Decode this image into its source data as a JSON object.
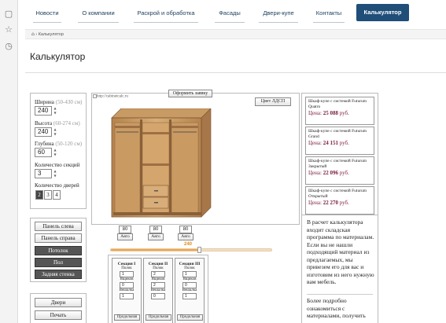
{
  "nav": {
    "items": [
      "Новости",
      "О компании",
      "Раскрой и обработка",
      "Фасады",
      "Двери-купе",
      "Контакты",
      "Калькулятор"
    ]
  },
  "breadcrumb": {
    "home_icon": "home-icon",
    "separator": "›",
    "current": "Калькулятор"
  },
  "page": {
    "title": "Калькулятор"
  },
  "form": {
    "width_label": "Ширина",
    "width_range": "(50-430 см)",
    "width_value": "240",
    "height_label": "Высота",
    "height_range": "(60-274 см)",
    "height_value": "240",
    "depth_label": "Глубина",
    "depth_range": "(50-120 см)",
    "depth_value": "60",
    "sections_label": "Количество секций",
    "sections_value": "3",
    "doors_label": "Количество дверей",
    "doors_options": [
      "2",
      "3",
      "4"
    ],
    "doors_selected": "2"
  },
  "panel_buttons": [
    "Панель слева",
    "Панель справа",
    "Потолок",
    "Пол",
    "Задняя стенка"
  ],
  "bottom_buttons": [
    "Двери",
    "Печать"
  ],
  "preview": {
    "order_button": "Оформить заявку",
    "color_button": "Цвет ЛДСП",
    "image_alt": "http://cabinetcalc.ru",
    "width_slider_value": "240",
    "width_slider_fraction": 0.55,
    "section_widths": [
      "80",
      "80",
      "80"
    ],
    "auto_label": "Авто"
  },
  "sections": [
    {
      "title": "Секция I",
      "shelf_label": "Полок",
      "shelf": "1",
      "drawer_label": "Ящиков",
      "drawer": "0",
      "hanger_label": "Вешалка",
      "hanger": "1",
      "button": "Продольная"
    },
    {
      "title": "Секция II",
      "shelf_label": "Полок",
      "shelf": "2",
      "drawer_label": "Ящиков",
      "drawer": "2",
      "hanger_label": "Вешалка",
      "hanger": "0",
      "button": "Продольная"
    },
    {
      "title": "Секция III",
      "shelf_label": "Полок",
      "shelf": "1",
      "drawer_label": "Ящиков",
      "drawer": "0",
      "hanger_label": "Вешалка",
      "hanger": "1",
      "button": "Продольная"
    }
  ],
  "products": [
    {
      "name": "Шкаф-купе с системой Futurum Quatro",
      "price_label": "Цена:",
      "price": "25 088",
      "currency": "руб."
    },
    {
      "name": "Шкаф-купе с системой Futurum Grand",
      "price_label": "Цена:",
      "price": "24 151",
      "currency": "руб."
    },
    {
      "name": "Шкаф-купе с системой Futurum Закрытый",
      "price_label": "Цена:",
      "price": "22 096",
      "currency": "руб."
    },
    {
      "name": "Шкаф-купе с системой Futurum Открытый",
      "price_label": "Цена:",
      "price": "22 270",
      "currency": "руб."
    }
  ],
  "info": {
    "text1": "В расчет калькулятора входит складская программа по материалам. Если вы не нашли подходящий материал из предлагаемых, мы привезем его для вас и изготовим из него нужную вам мебель.",
    "text2": "Более подробно ознакомиться с материалами, получить"
  },
  "colors": {
    "accent": "#1f4e79",
    "price": "#7a1a3a",
    "wood": "#c89a64",
    "wood_dark": "#8a6038"
  }
}
